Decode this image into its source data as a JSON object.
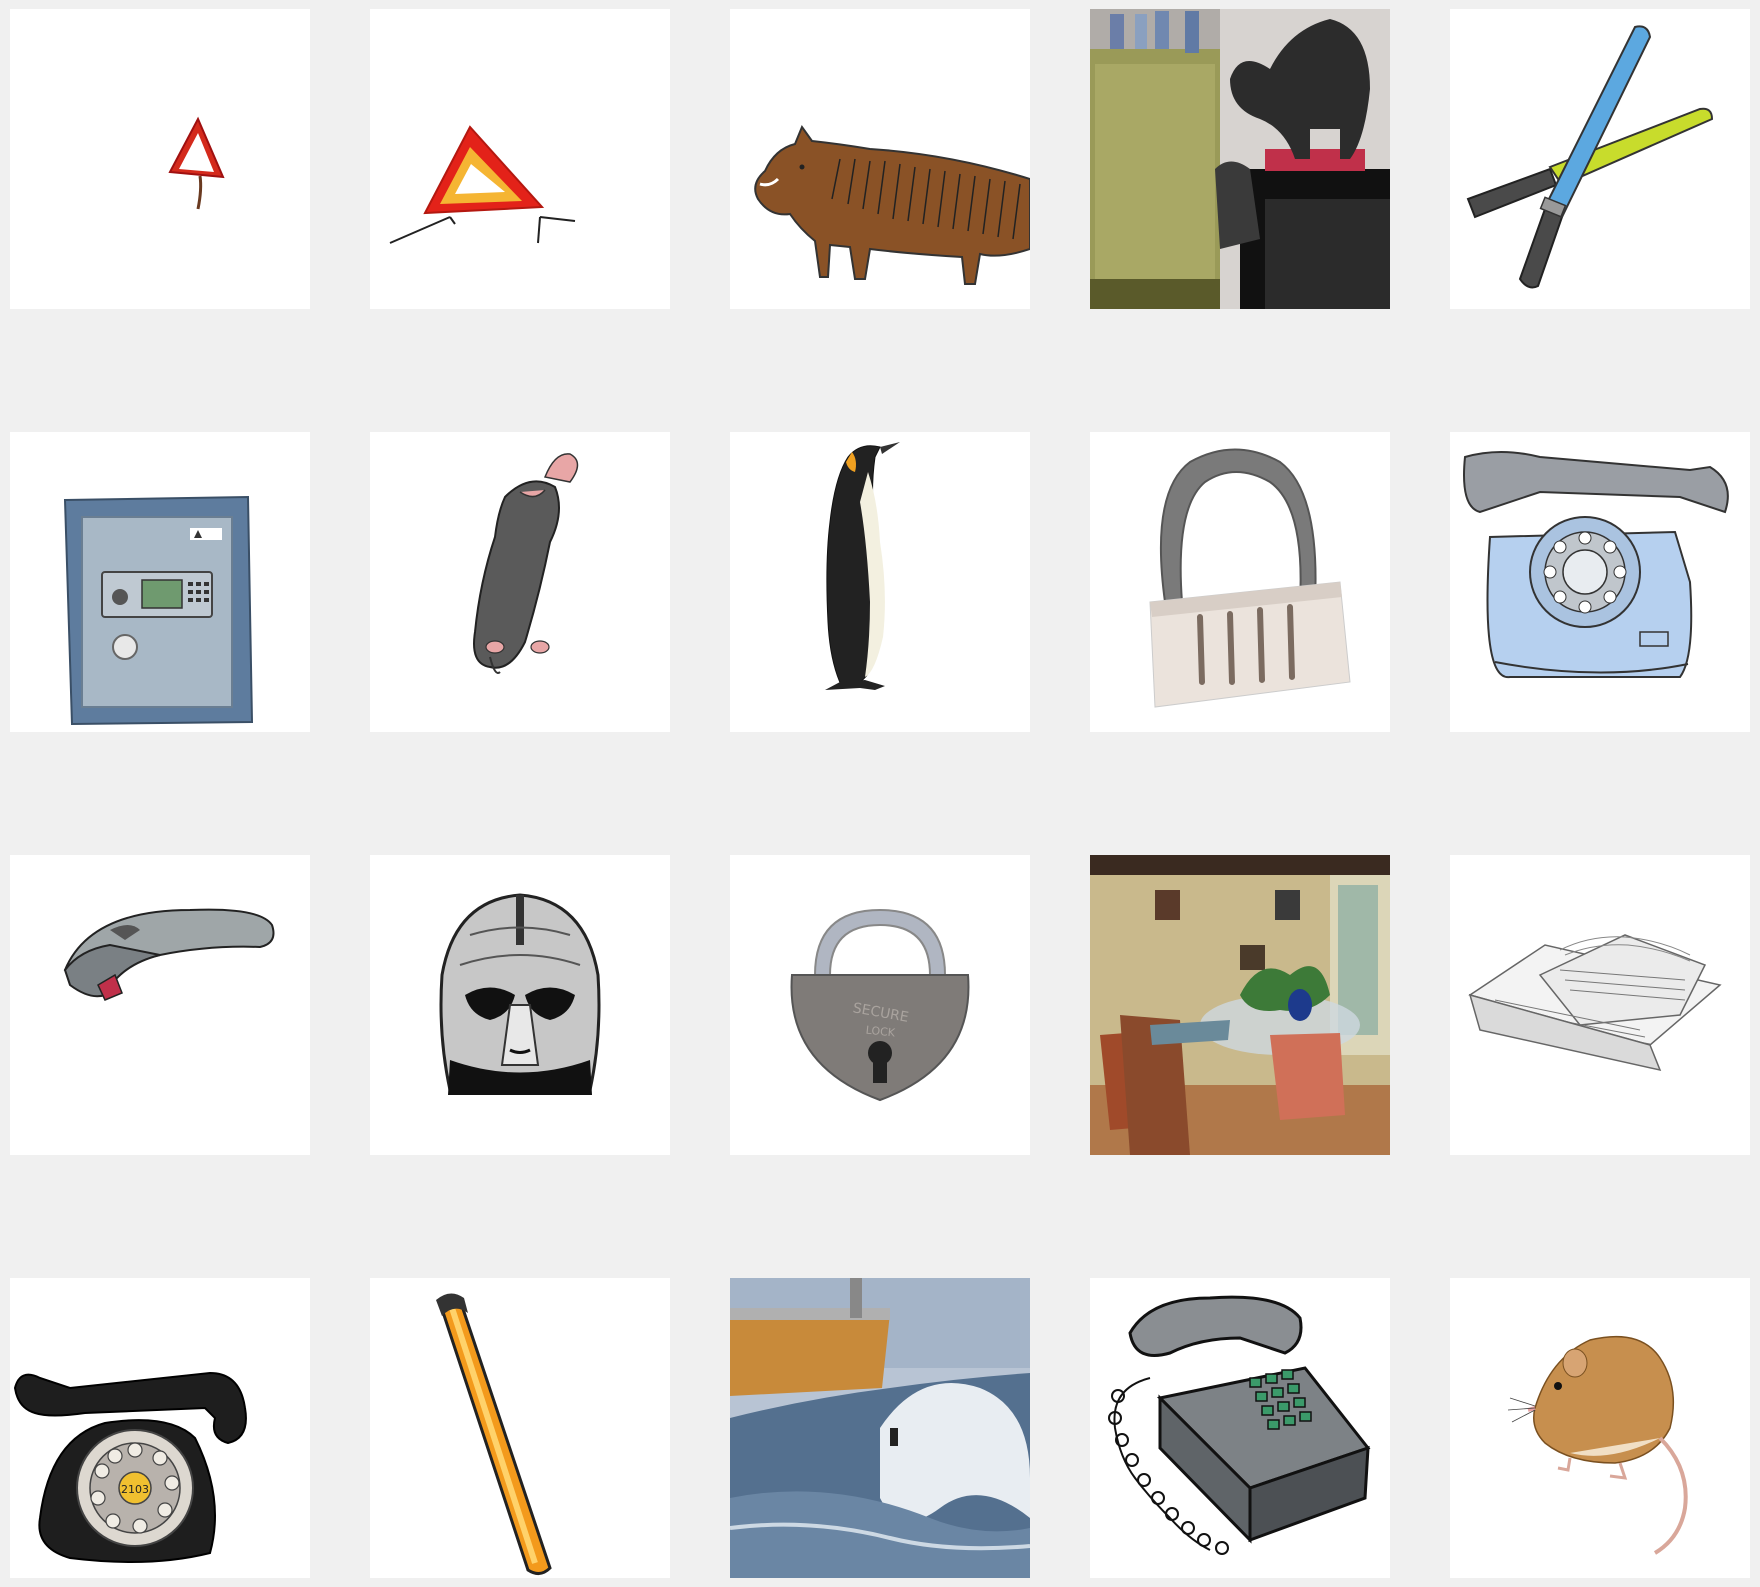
{
  "grid": {
    "rows": 4,
    "columns": 5,
    "background": "#f0f0f0",
    "tile_background": "#ffffff"
  },
  "tiles": [
    {
      "icon": "warning-triangle-small-icon"
    },
    {
      "icon": "warning-triangle-icon"
    },
    {
      "icon": "boar-icon"
    },
    {
      "icon": "cats-aquarium-photo"
    },
    {
      "icon": "glow-sticks-icon"
    },
    {
      "icon": "safe-icon"
    },
    {
      "icon": "mole-icon"
    },
    {
      "icon": "penguin-icon"
    },
    {
      "icon": "padlock-photo"
    },
    {
      "icon": "rotary-phone-blue-icon"
    },
    {
      "icon": "barcode-scanner-icon"
    },
    {
      "icon": "helmet-icon"
    },
    {
      "icon": "padlock-icon"
    },
    {
      "icon": "dining-room-photo"
    },
    {
      "icon": "calculator-stand-icon"
    },
    {
      "icon": "rotary-phone-black-icon"
    },
    {
      "icon": "light-stick-orange-icon"
    },
    {
      "icon": "surfer-wave-photo"
    },
    {
      "icon": "push-button-phone-icon"
    },
    {
      "icon": "mouse-icon"
    }
  ],
  "text": {
    "padlock_engraving_1": "SECURE",
    "padlock_engraving_2": "LOCK",
    "dial_center_label": "2103"
  }
}
